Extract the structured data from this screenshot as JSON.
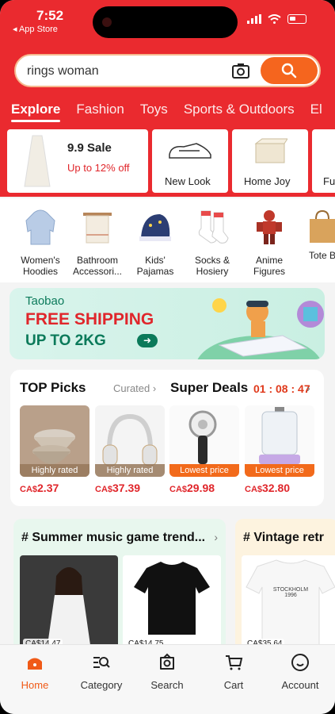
{
  "status": {
    "time": "7:52",
    "back": "◂ App Store"
  },
  "search": {
    "query": "rings woman"
  },
  "tabs": [
    "Explore",
    "Fashion",
    "Toys",
    "Sports & Outdoors",
    "El"
  ],
  "cards": [
    {
      "title": "9.9 Sale",
      "subtitle": "Up to 12% off"
    },
    {
      "label": "New Look"
    },
    {
      "label": "Home Joy"
    },
    {
      "label": "Fu"
    }
  ],
  "categories": [
    "Women's\nHoodies",
    "Bathroom\nAccessori...",
    "Kids'\nPajamas",
    "Socks &\nHosiery",
    "Anime\nFigures",
    "Tote B"
  ],
  "banner": {
    "brand": "Taobao",
    "line1": "FREE SHIPPING",
    "line2": "UP TO 2KG"
  },
  "picks": {
    "title": "TOP Picks",
    "curated": "Curated",
    "deals": "Super Deals",
    "timer": "01 : 08 : 47",
    "items": [
      {
        "tag": "Highly rated",
        "currency": "CA$",
        "price": "2.37"
      },
      {
        "tag": "Highly rated",
        "currency": "CA$",
        "price": "37.39"
      },
      {
        "tag": "Lowest price",
        "currency": "CA$",
        "price": "29.98"
      },
      {
        "tag": "Lowest price",
        "currency": "CA$",
        "price": "32.80"
      }
    ]
  },
  "feed": {
    "left_title": "# Summer music game trend...",
    "right_title": "# Vintage retr",
    "prices": [
      "CA$14.47",
      "CA$14.75",
      "CA$35.64"
    ],
    "shirt_text": "STOCKHOLM\n1996"
  },
  "nav": [
    "Home",
    "Category",
    "Search",
    "Cart",
    "Account"
  ]
}
